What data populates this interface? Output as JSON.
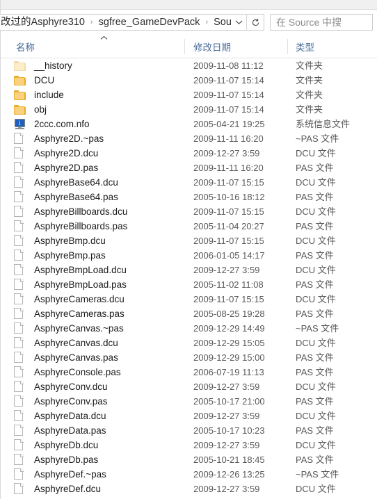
{
  "window": {
    "type": "file-explorer"
  },
  "address_bar": {
    "breadcrumbs": [
      "改过的Asphyre310",
      "sgfree_GameDevPack",
      "Source"
    ],
    "separator": "›",
    "dropdown_icon": "chevron-down-icon",
    "refresh_icon": "refresh-icon",
    "refresh_label": "↻"
  },
  "search": {
    "placeholder": "在 Source 中搜",
    "value": ""
  },
  "columns": {
    "name": "名称",
    "date_modified": "修改日期",
    "type": "类型",
    "sort_indicator": "ascending"
  },
  "files": [
    {
      "name": "__history",
      "date": "2009-11-08 11:12",
      "type": "文件夹",
      "icon": "folder-dim-icon"
    },
    {
      "name": "DCU",
      "date": "2009-11-07 15:14",
      "type": "文件夹",
      "icon": "folder-icon"
    },
    {
      "name": "include",
      "date": "2009-11-07 15:14",
      "type": "文件夹",
      "icon": "folder-icon"
    },
    {
      "name": "obj",
      "date": "2009-11-07 15:14",
      "type": "文件夹",
      "icon": "folder-icon"
    },
    {
      "name": "2ccc.com.nfo",
      "date": "2005-04-21 19:25",
      "type": "系统信息文件",
      "icon": "system-info-icon"
    },
    {
      "name": "Asphyre2D.~pas",
      "date": "2009-11-11 16:20",
      "type": "~PAS 文件",
      "icon": "document-icon"
    },
    {
      "name": "Asphyre2D.dcu",
      "date": "2009-12-27 3:59",
      "type": "DCU 文件",
      "icon": "document-icon"
    },
    {
      "name": "Asphyre2D.pas",
      "date": "2009-11-11 16:20",
      "type": "PAS 文件",
      "icon": "document-icon"
    },
    {
      "name": "AsphyreBase64.dcu",
      "date": "2009-11-07 15:15",
      "type": "DCU 文件",
      "icon": "document-icon"
    },
    {
      "name": "AsphyreBase64.pas",
      "date": "2005-10-16 18:12",
      "type": "PAS 文件",
      "icon": "document-icon"
    },
    {
      "name": "AsphyreBillboards.dcu",
      "date": "2009-11-07 15:15",
      "type": "DCU 文件",
      "icon": "document-icon"
    },
    {
      "name": "AsphyreBillboards.pas",
      "date": "2005-11-04 20:27",
      "type": "PAS 文件",
      "icon": "document-icon"
    },
    {
      "name": "AsphyreBmp.dcu",
      "date": "2009-11-07 15:15",
      "type": "DCU 文件",
      "icon": "document-icon"
    },
    {
      "name": "AsphyreBmp.pas",
      "date": "2006-01-05 14:17",
      "type": "PAS 文件",
      "icon": "document-icon"
    },
    {
      "name": "AsphyreBmpLoad.dcu",
      "date": "2009-12-27 3:59",
      "type": "DCU 文件",
      "icon": "document-icon"
    },
    {
      "name": "AsphyreBmpLoad.pas",
      "date": "2005-11-02 11:08",
      "type": "PAS 文件",
      "icon": "document-icon"
    },
    {
      "name": "AsphyreCameras.dcu",
      "date": "2009-11-07 15:15",
      "type": "DCU 文件",
      "icon": "document-icon"
    },
    {
      "name": "AsphyreCameras.pas",
      "date": "2005-08-25 19:28",
      "type": "PAS 文件",
      "icon": "document-icon"
    },
    {
      "name": "AsphyreCanvas.~pas",
      "date": "2009-12-29 14:49",
      "type": "~PAS 文件",
      "icon": "document-icon"
    },
    {
      "name": "AsphyreCanvas.dcu",
      "date": "2009-12-29 15:05",
      "type": "DCU 文件",
      "icon": "document-icon"
    },
    {
      "name": "AsphyreCanvas.pas",
      "date": "2009-12-29 15:00",
      "type": "PAS 文件",
      "icon": "document-icon"
    },
    {
      "name": "AsphyreConsole.pas",
      "date": "2006-07-19 11:13",
      "type": "PAS 文件",
      "icon": "document-icon"
    },
    {
      "name": "AsphyreConv.dcu",
      "date": "2009-12-27 3:59",
      "type": "DCU 文件",
      "icon": "document-icon"
    },
    {
      "name": "AsphyreConv.pas",
      "date": "2005-10-17 21:00",
      "type": "PAS 文件",
      "icon": "document-icon"
    },
    {
      "name": "AsphyreData.dcu",
      "date": "2009-12-27 3:59",
      "type": "DCU 文件",
      "icon": "document-icon"
    },
    {
      "name": "AsphyreData.pas",
      "date": "2005-10-17 10:23",
      "type": "PAS 文件",
      "icon": "document-icon"
    },
    {
      "name": "AsphyreDb.dcu",
      "date": "2009-12-27 3:59",
      "type": "DCU 文件",
      "icon": "document-icon"
    },
    {
      "name": "AsphyreDb.pas",
      "date": "2005-10-21 18:45",
      "type": "PAS 文件",
      "icon": "document-icon"
    },
    {
      "name": "AsphyreDef.~pas",
      "date": "2009-12-26 13:25",
      "type": "~PAS 文件",
      "icon": "document-icon"
    },
    {
      "name": "AsphyreDef.dcu",
      "date": "2009-12-27 3:59",
      "type": "DCU 文件",
      "icon": "document-icon"
    }
  ],
  "colors": {
    "header_text": "#4a6d9a",
    "folder": "#fbd27b",
    "nfo_screen": "#1f5fbd",
    "file_text": "#1b1b1b",
    "meta_text": "#595959"
  }
}
